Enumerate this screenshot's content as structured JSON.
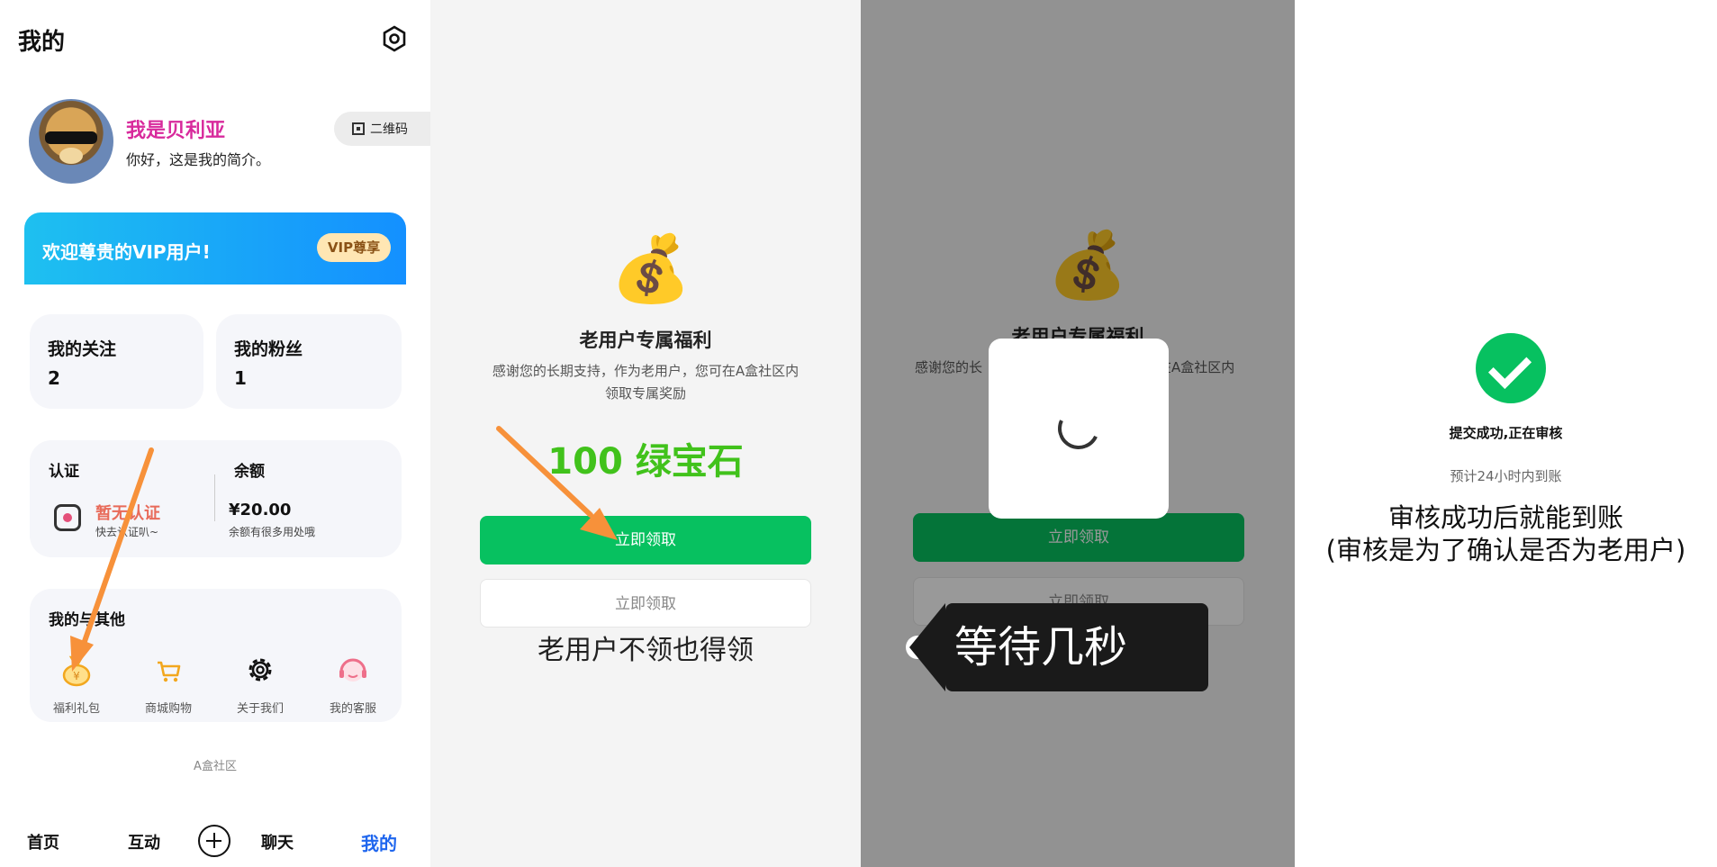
{
  "panel1": {
    "title": "我的",
    "profile": {
      "name": "我是贝利亚",
      "bio": "你好，这是我的简介。",
      "qr_label": "二维码"
    },
    "vip": {
      "text": "欢迎尊贵的VIP用户!",
      "button": "VIP尊享"
    },
    "follow": {
      "label": "我的关注",
      "count": "2"
    },
    "fans": {
      "label": "我的粉丝",
      "count": "1"
    },
    "auth": {
      "label": "认证",
      "status": "暂无认证",
      "hint": "快去认证叭~"
    },
    "balance": {
      "label": "余额",
      "amount": "¥20.00",
      "hint": "余额有很多用处哦"
    },
    "more": {
      "title": "我的与其他",
      "items": [
        {
          "label": "福利礼包",
          "icon": "money-bag-icon"
        },
        {
          "label": "商城购物",
          "icon": "cart-icon"
        },
        {
          "label": "关于我们",
          "icon": "gear-icon"
        },
        {
          "label": "我的客服",
          "icon": "headset-icon"
        }
      ]
    },
    "brand": "A盒社区",
    "tabs": [
      {
        "label": "首页"
      },
      {
        "label": "互动"
      },
      {
        "label": "聊天"
      },
      {
        "label": "我的"
      }
    ]
  },
  "panel2": {
    "title": "老用户专属福利",
    "desc_line1": "感谢您的长期支持，作为老用户，您可在A盒社区内",
    "desc_line2": "领取专属奖励",
    "reward": "100 绿宝石",
    "claim_button": "立即领取",
    "secondary_button": "立即领取",
    "caption": "老用户不领也得领"
  },
  "panel3": {
    "title": "老用户专属福利",
    "desc_left": "感谢您的长",
    "desc_right": "在A盒社区内",
    "claim_button": "立即领取",
    "secondary_button": "立即领取",
    "tip": "等待几秒"
  },
  "panel4": {
    "status": "提交成功,正在审核",
    "eta": "预计24小时内到账",
    "note_line1": "审核成功后就能到账",
    "note_line2": "(审核是为了确认是否为老用户)"
  },
  "colors": {
    "accent_green": "#07c160",
    "reward_green": "#41c21b",
    "vip_blue": "#1490ff",
    "arrow_orange": "#f7913a",
    "name_pink": "#d82a9c",
    "active_tab": "#1f66ee"
  }
}
